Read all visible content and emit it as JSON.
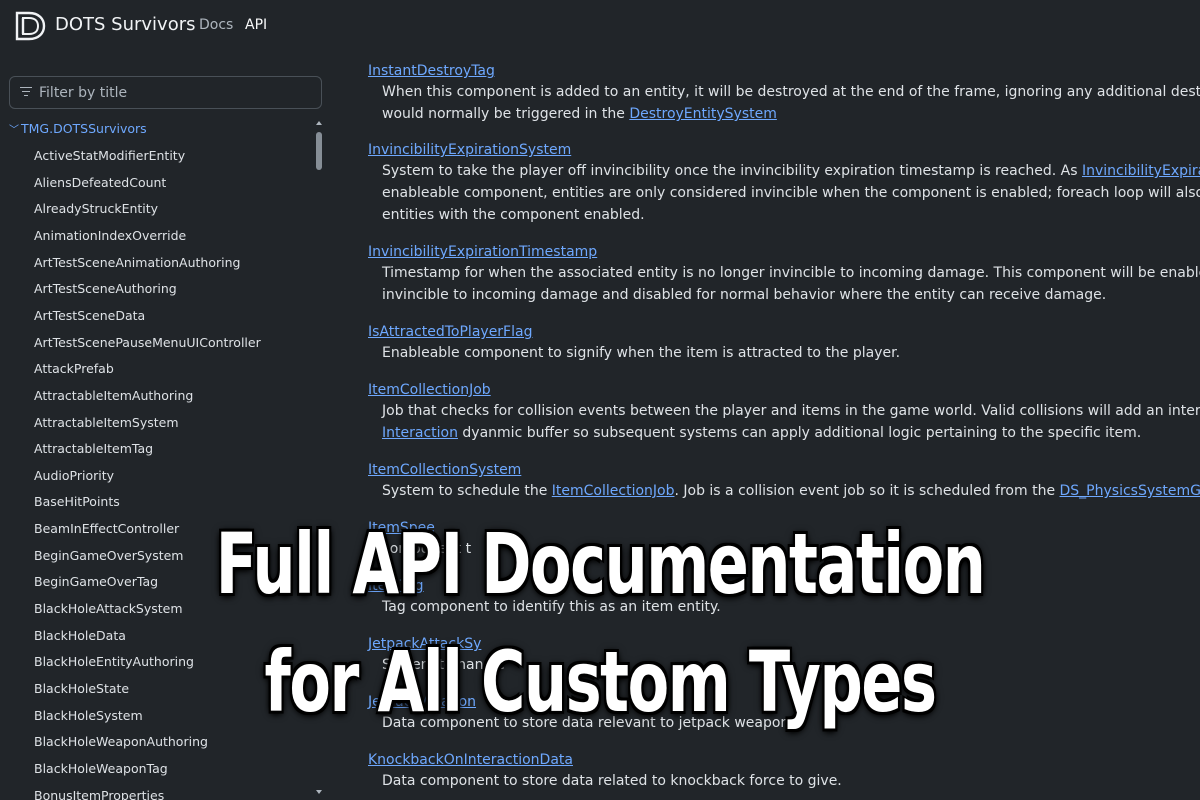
{
  "header": {
    "logo_icon": "D-logo-icon",
    "site_title": "DOTS Survivors",
    "nav": [
      {
        "label": "Docs"
      },
      {
        "label": "API"
      }
    ]
  },
  "sidebar": {
    "filter_placeholder": "Filter by title",
    "filter_icon": "filter-lines-icon",
    "root": {
      "label": "TMG.DOTSSurvivors",
      "icon": "chevron-down-icon"
    },
    "items": [
      "ActiveStatModifierEntity",
      "AliensDefeatedCount",
      "AlreadyStruckEntity",
      "AnimationIndexOverride",
      "ArtTestSceneAnimationAuthoring",
      "ArtTestSceneAuthoring",
      "ArtTestSceneData",
      "ArtTestScenePauseMenuUIController",
      "AttackPrefab",
      "AttractableItemAuthoring",
      "AttractableItemSystem",
      "AttractableItemTag",
      "AudioPriority",
      "BaseHitPoints",
      "BeamInEffectController",
      "BeginGameOverSystem",
      "BeginGameOverTag",
      "BlackHoleAttackSystem",
      "BlackHoleData",
      "BlackHoleEntityAuthoring",
      "BlackHoleState",
      "BlackHoleSystem",
      "BlackHoleWeaponAuthoring",
      "BlackHoleWeaponTag",
      "BonusItemProperties"
    ]
  },
  "entries": [
    {
      "title": "InstantDestroyTag",
      "lines": [
        [
          {
            "t": "When this component is added to an entity, it will be destroyed at the end of the frame, ignoring any additional destruction logi"
          }
        ],
        [
          {
            "t": "would normally be triggered in the "
          },
          {
            "t": "DestroyEntitySystem",
            "link": true
          }
        ]
      ]
    },
    {
      "title": "InvincibilityExpirationSystem",
      "lines": [
        [
          {
            "t": "System to take the player off invincibility once the invincibility expiration timestamp is reached. As "
          },
          {
            "t": "InvincibilityExpirationTimestar",
            "link": true
          }
        ],
        [
          {
            "t": "enableable component, entities are only considered invincible when the component is enabled; foreach loop will also only iterat"
          }
        ],
        [
          {
            "t": "entities with the component enabled."
          }
        ]
      ]
    },
    {
      "title": "InvincibilityExpirationTimestamp",
      "lines": [
        [
          {
            "t": "Timestamp for when the associated entity is no longer invincible to incoming damage. This component will be enabled when the"
          }
        ],
        [
          {
            "t": "invincible to incoming damage and disabled for normal behavior where the entity can receive damage."
          }
        ]
      ]
    },
    {
      "title": "IsAttractedToPlayerFlag",
      "lines": [
        [
          {
            "t": "Enableable component to signify when the item is attracted to the player."
          }
        ]
      ]
    },
    {
      "title": "ItemCollectionJob",
      "lines": [
        [
          {
            "t": "Job that checks for collision events between the player and items in the game world. Valid collisions will add an interaction to the"
          }
        ],
        [
          {
            "t": "Interaction",
            "link": true
          },
          {
            "t": " dyanmic buffer so subsequent systems can apply additional logic pertaining to the specific item."
          }
        ]
      ]
    },
    {
      "title": "ItemCollectionSystem",
      "lines": [
        [
          {
            "t": "System to schedule the "
          },
          {
            "t": "ItemCollectionJob",
            "link": true
          },
          {
            "t": ". Job is a collision event job so it is scheduled from the "
          },
          {
            "t": "DS_PhysicsSystemGroup",
            "link": true
          },
          {
            "t": "."
          }
        ]
      ]
    },
    {
      "title": "ItemSpee",
      "lines": [
        [
          {
            "t": "component t"
          }
        ]
      ]
    },
    {
      "title": "ItemTag",
      "lines": [
        [
          {
            "t": "Tag component to identify this as an item entity."
          }
        ]
      ]
    },
    {
      "title": "JetpackAttackSy",
      "lines": [
        [
          {
            "t": "System to handle"
          }
        ]
      ]
    },
    {
      "title": "JetpackWeapon",
      "lines": [
        [
          {
            "t": "Data component to store data relevant to jetpack weapon."
          }
        ]
      ]
    },
    {
      "title": "KnockbackOnInteractionData",
      "lines": [
        [
          {
            "t": "Data component to store data related to knockback force to give."
          }
        ]
      ]
    }
  ],
  "overlay": {
    "line1": "Full API Documentation",
    "line2": "for All Custom Types"
  }
}
